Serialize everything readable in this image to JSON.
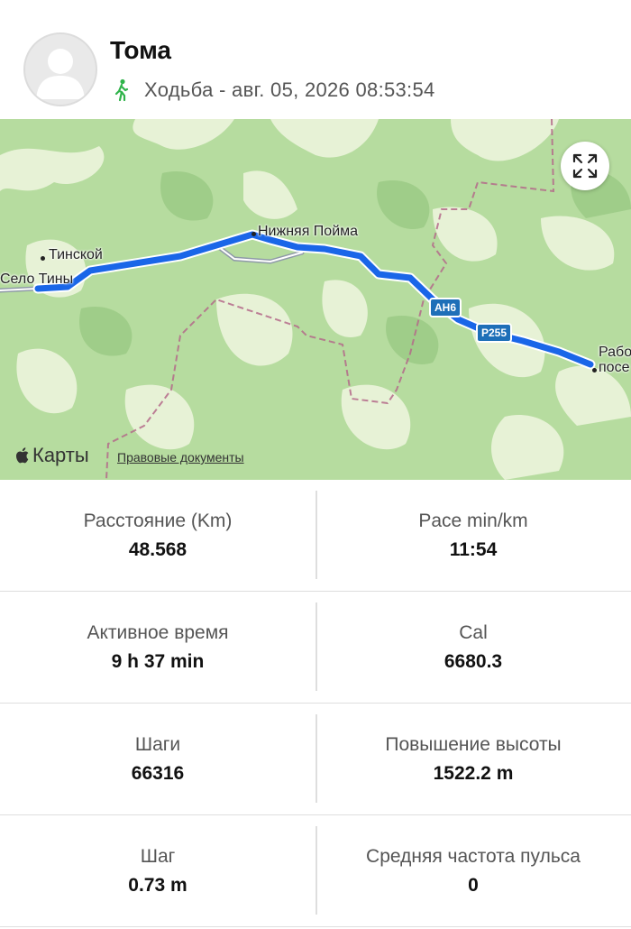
{
  "user": {
    "name": "Тома",
    "activity": "Ходьба - авг. 05, 2026 08:53:54",
    "avatar_icon": "user-avatar-placeholder",
    "activity_icon": "walking-icon"
  },
  "map": {
    "places": {
      "tinskoy": "Тинской",
      "selo_tiny": "Село Тины",
      "nizhnyaya_poyma": "Нижняя Пойма",
      "raboch": "Рабо",
      "posel": "посе"
    },
    "roads": {
      "ah6": "АН6",
      "r255": "Р255"
    },
    "brand": "Карты",
    "legal": "Правовые документы",
    "expand_icon": "expand-icon",
    "route_color": "#1a66e8"
  },
  "stats": [
    {
      "left": {
        "label": "Расстояние (Km)",
        "value": "48.568"
      },
      "right": {
        "label": "Pace min/km",
        "value": "11:54"
      }
    },
    {
      "left": {
        "label": "Активное время",
        "value": "9 h 37 min"
      },
      "right": {
        "label": "Cal",
        "value": "6680.3"
      }
    },
    {
      "left": {
        "label": "Шаги",
        "value": "66316"
      },
      "right": {
        "label": "Повышение высоты",
        "value": "1522.2 m"
      }
    },
    {
      "left": {
        "label": "Шаг",
        "value": "0.73 m"
      },
      "right": {
        "label": "Средняя частота пульса",
        "value": "0"
      }
    }
  ]
}
